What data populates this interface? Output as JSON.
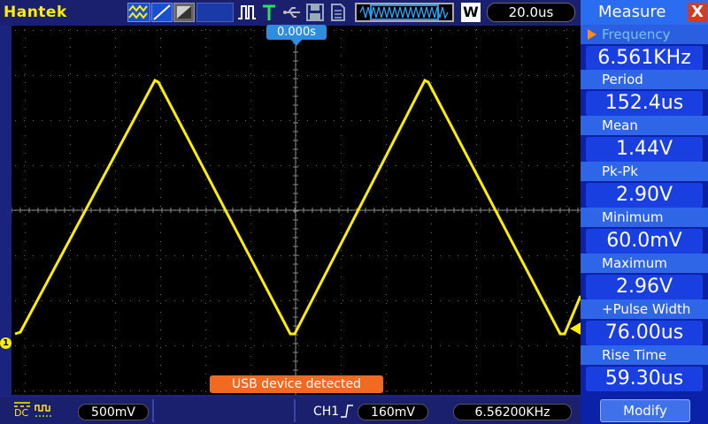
{
  "topbar": {
    "brand": "Hantek",
    "zoom_label": "W",
    "timebase": "20.0us",
    "icons": [
      "waveform-mode-icon",
      "ramp-icon",
      "contrast-icon",
      "pulse-trigger-icon",
      "trigger-t-icon",
      "usb-icon",
      "save-icon",
      "file-icon",
      "memory-waveform-icon"
    ]
  },
  "scope": {
    "time_offset": "0.000s",
    "channel_marker": "1",
    "notification": "USB device detected",
    "trace_color": "#ffee00",
    "waveform": "triangle"
  },
  "bottombar": {
    "coupling": "DC",
    "volts_div": "500mV",
    "trigger_channel": "CH1",
    "trigger_level": "160mV",
    "counter": "6.56200KHz"
  },
  "panel": {
    "title": "Measure",
    "close_label": "X",
    "measurements": [
      {
        "label": "Frequency",
        "value": "6.561KHz"
      },
      {
        "label": "Period",
        "value": "152.4us"
      },
      {
        "label": "Mean",
        "value": "1.44V"
      },
      {
        "label": "Pk-Pk",
        "value": "2.90V"
      },
      {
        "label": "Minimum",
        "value": "60.0mV"
      },
      {
        "label": "Maximum",
        "value": "2.96V"
      },
      {
        "label": "+Pulse Width",
        "value": "76.00us"
      },
      {
        "label": "Rise Time",
        "value": "59.30us"
      }
    ],
    "modify_label": "Modify"
  },
  "colors": {
    "accent": "#2a6df0",
    "trace": "#ffee00",
    "notification": "#f26a21",
    "close": "#d53b1e"
  }
}
